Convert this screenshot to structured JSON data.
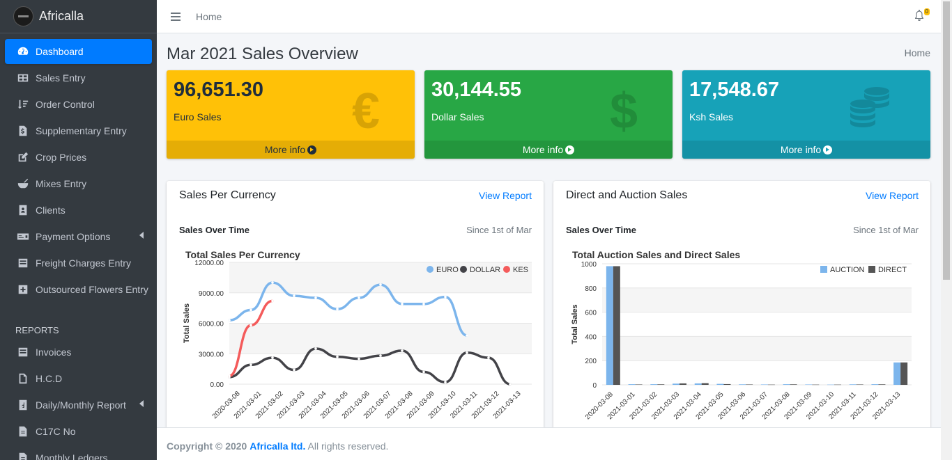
{
  "brand": {
    "name": "Africalla"
  },
  "sidebar": {
    "items": [
      {
        "label": "Dashboard",
        "icon": "dashboard-icon"
      },
      {
        "label": "Sales Entry",
        "icon": "table-icon"
      },
      {
        "label": "Order Control",
        "icon": "sort-icon"
      },
      {
        "label": "Supplementary Entry",
        "icon": "file-dollar-icon"
      },
      {
        "label": "Crop Prices",
        "icon": "edit-icon"
      },
      {
        "label": "Mixes Entry",
        "icon": "mortar-icon"
      },
      {
        "label": "Clients",
        "icon": "address-book-icon"
      },
      {
        "label": "Payment Options",
        "icon": "money-check-icon"
      },
      {
        "label": "Freight Charges Entry",
        "icon": "list-icon"
      },
      {
        "label": "Outsourced Flowers Entry",
        "icon": "plus-square-icon"
      }
    ],
    "reports_header": "REPORTS",
    "report_items": [
      {
        "label": "Invoices",
        "icon": "list-icon"
      },
      {
        "label": "H.C.D",
        "icon": "file-icon"
      },
      {
        "label": "Daily/Monthly Report",
        "icon": "file-d-icon"
      },
      {
        "label": "C17C No",
        "icon": "file-text-icon"
      },
      {
        "label": "Monthly Ledgers",
        "icon": "file-text-icon"
      }
    ]
  },
  "topbar": {
    "home": "Home",
    "notification_count": "0"
  },
  "page": {
    "title": "Mar 2021 Sales Overview",
    "breadcrumb": "Home"
  },
  "stats": [
    {
      "value": "96,651.30",
      "label": "Euro Sales",
      "more": "More info",
      "icon": "€",
      "color": "#ffc107"
    },
    {
      "value": "30,144.55",
      "label": "Dollar Sales",
      "more": "More info",
      "icon": "$",
      "color": "#28a745"
    },
    {
      "value": "17,548.67",
      "label": "Ksh Sales",
      "more": "More info",
      "icon": "coins-icon",
      "color": "#17a2b8"
    }
  ],
  "cards": {
    "left": {
      "title": "Sales Per Currency",
      "link": "View Report",
      "subtitle": "Sales Over Time",
      "since": "Since 1st of Mar"
    },
    "right": {
      "title": "Direct and Auction Sales",
      "link": "View Report",
      "subtitle": "Sales Over Time",
      "since": "Since 1st of Mar"
    }
  },
  "chart_data": [
    {
      "type": "line",
      "title": "Total Sales Per Currency",
      "ylabel": "Total Sales",
      "ylim": [
        0,
        12000
      ],
      "yticks": [
        "0.00",
        "3000.00",
        "6000.00",
        "9000.00",
        "12000.00"
      ],
      "categories": [
        "2020-03-08",
        "2021-03-01",
        "2021-03-02",
        "2021-03-03",
        "2021-03-04",
        "2021-03-05",
        "2021-03-06",
        "2021-03-07",
        "2021-03-08",
        "2021-03-09",
        "2021-03-10",
        "2021-03-11",
        "2021-03-12",
        "2021-03-13"
      ],
      "series": [
        {
          "name": "EURO",
          "color": "#7cb5ec",
          "values": [
            6300,
            7300,
            10000,
            8700,
            8500,
            7400,
            8500,
            9800,
            7900,
            7900,
            8600,
            4800,
            null,
            null
          ]
        },
        {
          "name": "DOLLAR",
          "color": "#434348",
          "values": [
            700,
            1900,
            2600,
            1400,
            3500,
            2700,
            2500,
            2800,
            3300,
            1200,
            200,
            3100,
            2600,
            0
          ]
        },
        {
          "name": "KES",
          "color": "#f45b5b",
          "values": [
            800,
            5800,
            8200,
            null,
            null,
            null,
            null,
            null,
            null,
            null,
            null,
            null,
            null,
            null
          ]
        }
      ],
      "legend": "top-right"
    },
    {
      "type": "bar",
      "title": "Total Auction Sales and Direct Sales",
      "ylabel": "Total Sales",
      "ylim": [
        0,
        1000
      ],
      "yticks": [
        "0",
        "200",
        "400",
        "600",
        "800",
        "1000"
      ],
      "categories": [
        "2020-03-08",
        "2021-03-01",
        "2021-03-02",
        "2021-03-03",
        "2021-03-04",
        "2021-03-05",
        "2021-03-06",
        "2021-03-07",
        "2021-03-08",
        "2021-03-09",
        "2021-03-10",
        "2021-03-11",
        "2021-03-12",
        "2021-03-13"
      ],
      "series": [
        {
          "name": "AUCTION",
          "color": "#7cb5ec",
          "values": [
            980,
            5,
            5,
            10,
            12,
            8,
            4,
            3,
            5,
            3,
            2,
            4,
            5,
            185
          ]
        },
        {
          "name": "DIRECT",
          "color": "#555555",
          "values": [
            980,
            3,
            4,
            12,
            14,
            6,
            3,
            2,
            4,
            2,
            2,
            3,
            4,
            185
          ]
        }
      ],
      "legend": "top-right"
    }
  ],
  "footer": {
    "copyright": "Copyright © 2020",
    "company": "Africalla ltd.",
    "rights": "All rights reserved."
  }
}
